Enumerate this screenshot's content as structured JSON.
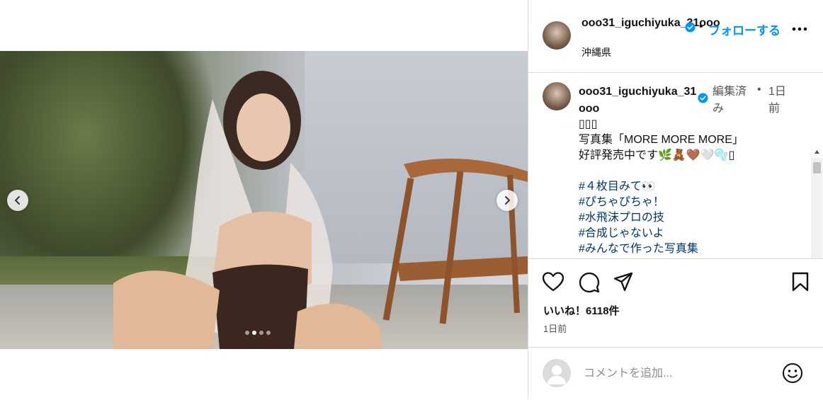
{
  "media": {
    "slide_count": 4,
    "active_slide": 2,
    "prev_label": "",
    "next_label": ""
  },
  "header": {
    "username": "ooo31_iguchiyuka_31ooo",
    "separator": "•",
    "follow_label": "フォローする",
    "location": "沖縄県",
    "more_icon": "more-horizontal-icon",
    "verified_icon": "verified-badge-icon"
  },
  "comment": {
    "username": "ooo31_iguchiyuka_31ooo",
    "edited": "編集済み",
    "separator": "•",
    "time": "1日前",
    "caption_lines": [
      "▯▯▯",
      "写真集「MORE MORE MORE」",
      "好評発売中です🌿🧸🤎🤍🫧▯"
    ],
    "hashtags": [
      "#４枚目みて👀",
      "#ぴちゃぴちゃ！",
      "#水飛沫プロの技",
      "#合成じゃないよ",
      "#みんなで作った写真集"
    ]
  },
  "actions": {
    "icons": [
      "heart-icon",
      "comment-icon",
      "share-icon",
      "bookmark-icon"
    ],
    "likes": "いいね！6118件",
    "posted": "1日前"
  },
  "comment_box": {
    "placeholder": "コメントを追加...",
    "emoji_icon": "emoji-icon"
  },
  "colors": {
    "accent": "#0095f6",
    "hashtag": "#00376b",
    "border": "#dbdbdb",
    "muted": "#555555"
  }
}
